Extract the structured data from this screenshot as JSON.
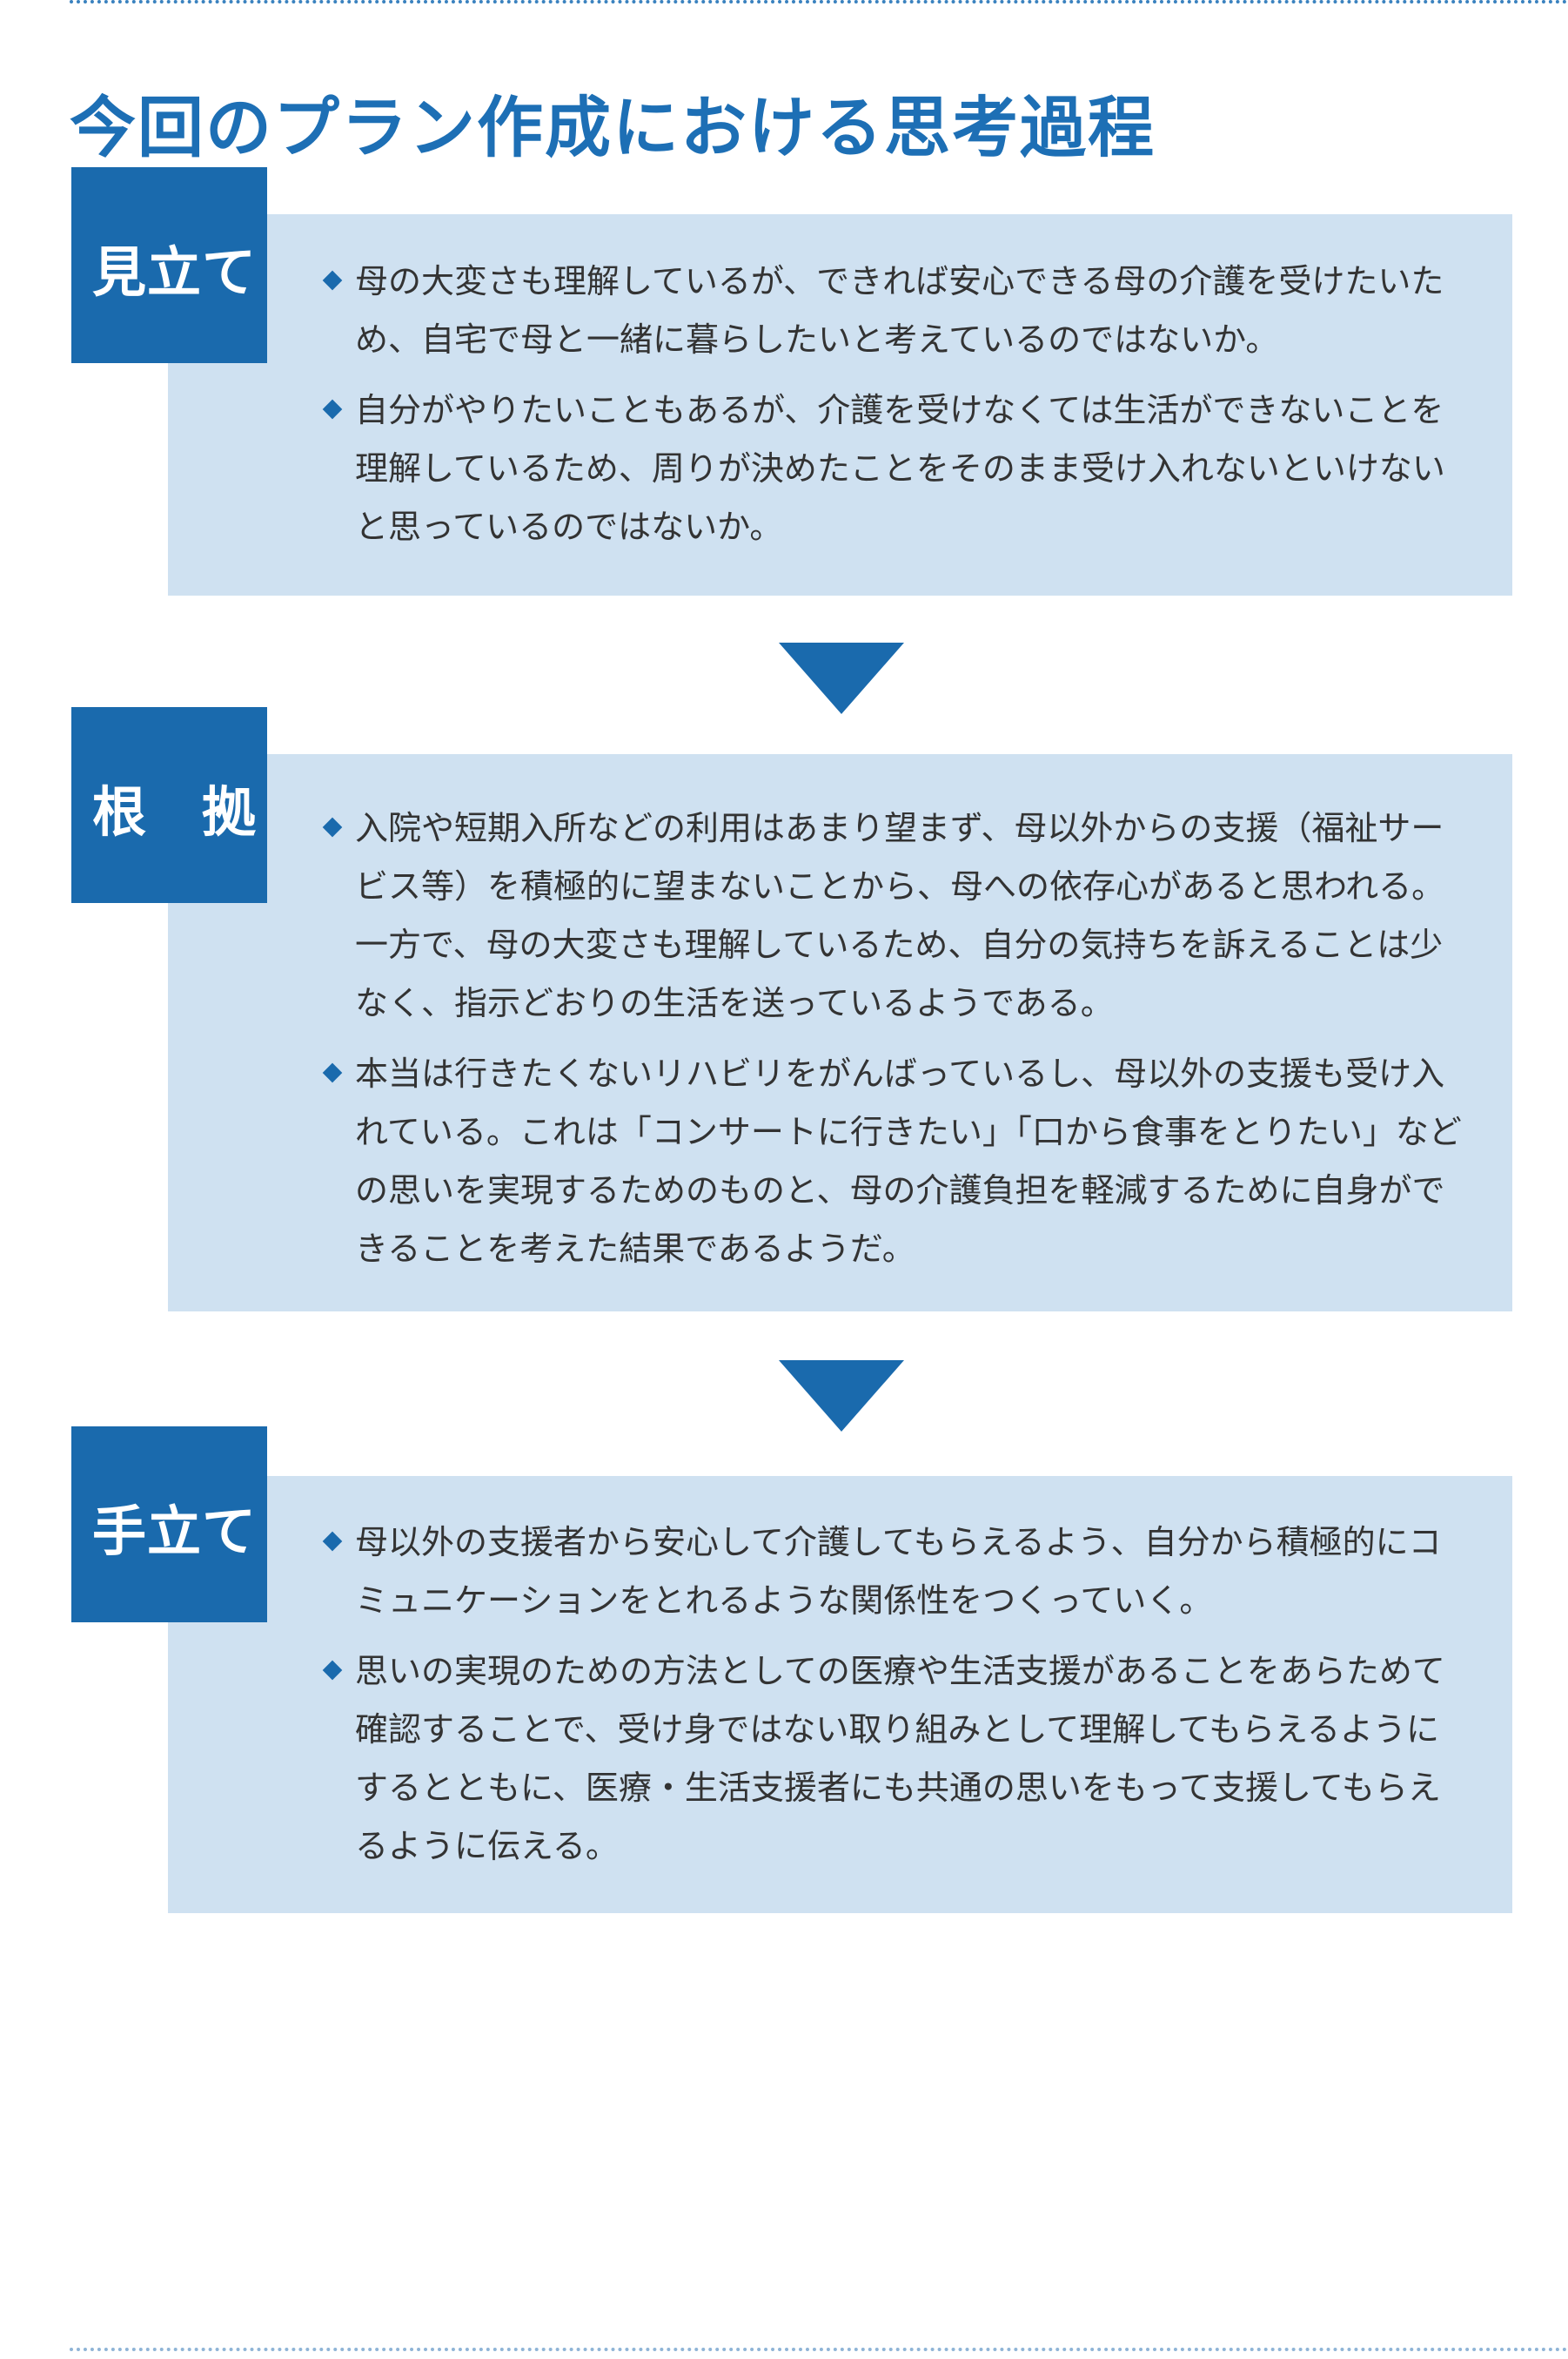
{
  "title": "今回のプラン作成における思考過程",
  "sections": [
    {
      "label": "見立て",
      "bullets": [
        "母の大変さも理解しているが、できれば安心できる母の介護を受けたいため、自宅で母と一緒に暮らしたいと考えているのではないか。",
        "自分がやりたいこともあるが、介護を受けなくては生活ができないことを理解しているため、周りが決めたことをそのまま受け入れないといけないと思っているのではないか。"
      ]
    },
    {
      "label": "根　拠",
      "bullets": [
        "入院や短期入所などの利用はあまり望まず、母以外からの支援（福祉サービス等）を積極的に望まないことから、母への依存心があると思われる。一方で、母の大変さも理解しているため、自分の気持ちを訴えることは少なく、指示どおりの生活を送っているようである。",
        "本当は行きたくないリハビリをがんばっているし、母以外の支援も受け入れている。これは「コンサートに行きたい」「口から食事をとりたい」などの思いを実現するためのものと、母の介護負担を軽減するために自身ができることを考えた結果であるようだ。"
      ]
    },
    {
      "label": "手立て",
      "bullets": [
        "母以外の支援者から安心して介護してもらえるよう、自分から積極的にコミュニケーションをとれるような関係性をつくっていく。",
        "思いの実現のための方法としての医療や生活支援があることをあらためて確認することで、受け身ではない取り組みとして理解してもらえるようにするとともに、医療・生活支援者にも共通の思いをもって支援してもらえるように伝える。"
      ]
    }
  ]
}
